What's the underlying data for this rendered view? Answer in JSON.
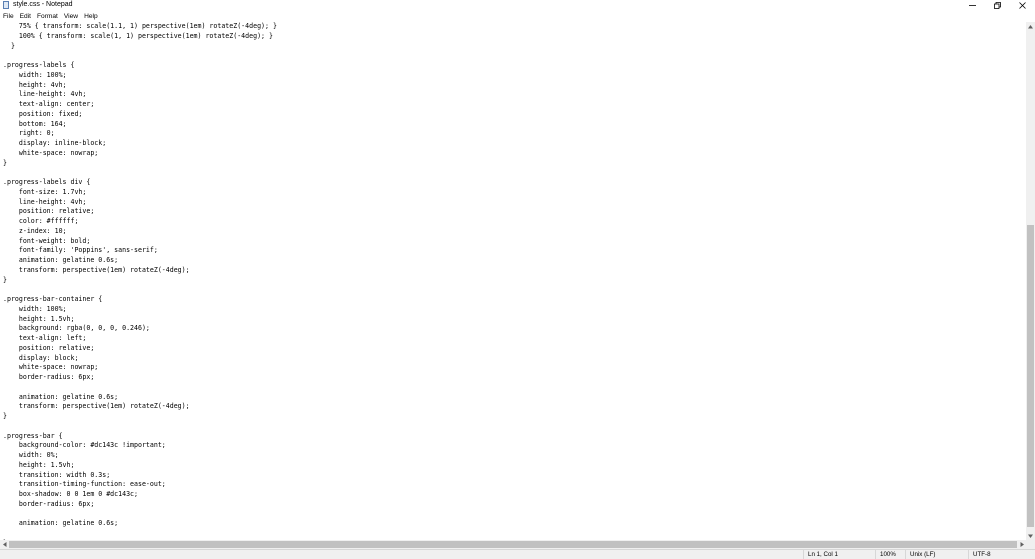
{
  "window": {
    "title": "style.css - Notepad",
    "icon": "notepad-icon"
  },
  "menu": {
    "items": [
      "File",
      "Edit",
      "Format",
      "View",
      "Help"
    ]
  },
  "editor": {
    "lines": [
      "    75% { transform: scale(1.1, 1) perspective(1em) rotateZ(-4deg); }",
      "    100% { transform: scale(1, 1) perspective(1em) rotateZ(-4deg); }",
      "  }",
      "",
      ".progress-labels {",
      "    width: 100%;",
      "    height: 4vh;",
      "    line-height: 4vh;",
      "    text-align: center;",
      "    position: fixed;",
      "    bottom: 164;",
      "    right: 0;",
      "    display: inline-block;",
      "    white-space: nowrap;",
      "}",
      "",
      ".progress-labels div {",
      "    font-size: 1.7vh;",
      "    line-height: 4vh;",
      "    position: relative;",
      "    color: #ffffff;",
      "    z-index: 10;",
      "    font-weight: bold;",
      "    font-family: 'Poppins', sans-serif;",
      "    animation: gelatine 0.6s;",
      "    transform: perspective(1em) rotateZ(-4deg);",
      "}",
      "",
      ".progress-bar-container {",
      "    width: 100%;",
      "    height: 1.5vh;",
      "    background: rgba(0, 0, 0, 0.246);",
      "    text-align: left;",
      "    position: relative;",
      "    display: block;",
      "    white-space: nowrap;",
      "    border-radius: 6px;",
      "",
      "    animation: gelatine 0.6s;",
      "    transform: perspective(1em) rotateZ(-4deg);",
      "}",
      "",
      ".progress-bar {",
      "    background-color: #dc143c !important;",
      "    width: 0%;",
      "    height: 1.5vh;",
      "    transition: width 0.3s;",
      "    transition-timing-function: ease-out;",
      "    box-shadow: 0 0 1em 0 #dc143c;",
      "    border-radius: 6px;",
      "",
      "    animation: gelatine 0.6s;",
      "",
      "}"
    ]
  },
  "status": {
    "position": "Ln 1, Col 1",
    "zoom": "100%",
    "line_ending": "Unix (LF)",
    "encoding": "UTF-8"
  },
  "colors": {
    "chrome": "#f0f0f0",
    "scroll_thumb": "#c1c1c1",
    "text": "#000000"
  }
}
